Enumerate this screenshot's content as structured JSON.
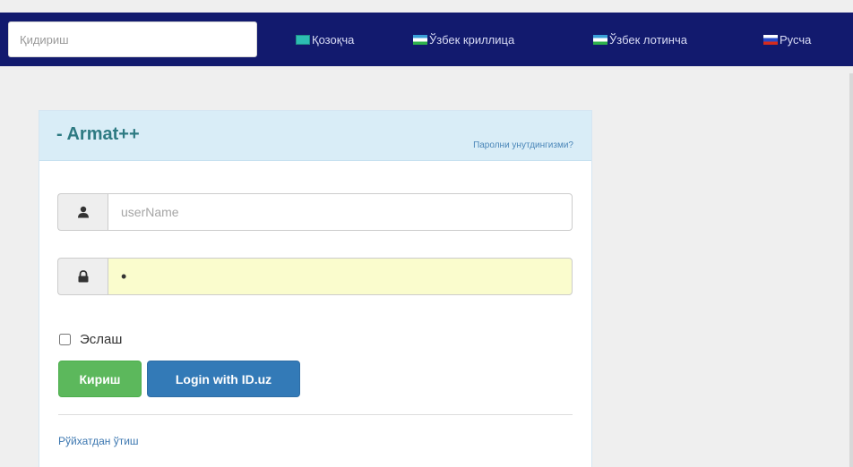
{
  "topbar": {
    "search": {
      "placeholder": "Қидириш",
      "value": ""
    },
    "languages": [
      {
        "label": "Қозоқча",
        "flag": "kz-flag-icon"
      },
      {
        "label": "Ўзбек криллица",
        "flag": "uz-flag-icon"
      },
      {
        "label": "Ўзбек лотинча",
        "flag": "uz-flag-icon"
      },
      {
        "label": "Русча",
        "flag": "ru-flag-icon"
      }
    ]
  },
  "login": {
    "title": "- Armat++",
    "forgot_password": "Паролни унутдингизми?",
    "username": {
      "placeholder": "userName",
      "value": "",
      "icon": "user-icon"
    },
    "password": {
      "value": "•",
      "icon": "lock-icon"
    },
    "remember_label": "Эслаш",
    "login_button": "Кириш",
    "id_login_button": "Login with ID.uz",
    "register_link": "Рўйхатдан ўтиш"
  },
  "colors": {
    "nav_bg": "#121a6e",
    "panel_heading_bg": "#d9edf7",
    "success": "#5cb85c",
    "primary": "#337ab7",
    "autofill": "#fafccd"
  }
}
